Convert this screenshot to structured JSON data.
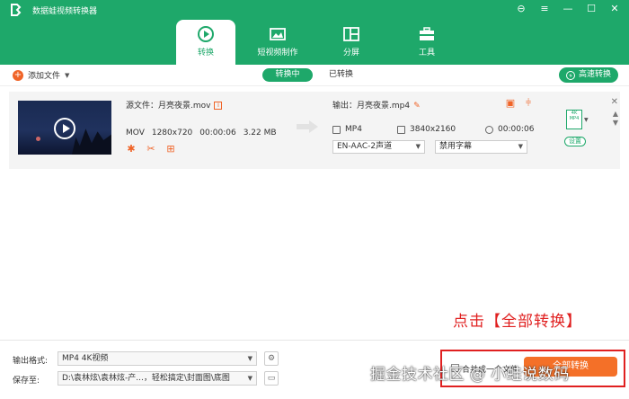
{
  "app": {
    "title": "数据蛙视频转换器"
  },
  "window_controls": [
    "⊖",
    "≡",
    "—",
    "☐",
    "✕"
  ],
  "tabs": [
    {
      "label": "转换",
      "icon": "convert-icon",
      "active": true
    },
    {
      "label": "短视频制作",
      "icon": "video-maker-icon",
      "active": false
    },
    {
      "label": "分屏",
      "icon": "split-screen-icon",
      "active": false
    },
    {
      "label": "工具",
      "icon": "toolbox-icon",
      "active": false
    }
  ],
  "toolbar": {
    "add_file": "添加文件",
    "converting": "转换中",
    "converted": "已转换",
    "fast_convert": "高速转换"
  },
  "file": {
    "source_label": "源文件：月亮夜景.mov",
    "format": "MOV",
    "resolution": "1280x720",
    "duration": "00:00:06",
    "size": "3.22 MB",
    "output_label": "输出：月亮夜景.mp4",
    "out_format": "MP4",
    "out_resolution": "3840x2160",
    "out_duration": "00:00:06",
    "audio_track": "EN-AAC-2声道",
    "subtitle": "禁用字幕",
    "format_card_label": "4K",
    "format_card_sub": "MP4",
    "settings": "设置"
  },
  "annotation": "点击【全部转换】",
  "footer": {
    "output_format_label": "输出格式:",
    "output_format_value": "MP4 4K视频",
    "save_to_label": "保存至:",
    "save_to_value": "D:\\袁林炫\\袁林炫-产...，轻松搞定\\封面图\\底图",
    "merge_label": "合并成一个文件",
    "convert_all": "全部转换"
  },
  "watermark": "掘金技术社区 @ 小蛙说数码",
  "colors": {
    "brand": "#1ea86a",
    "accent": "#f47028",
    "annotation": "#e02020"
  }
}
